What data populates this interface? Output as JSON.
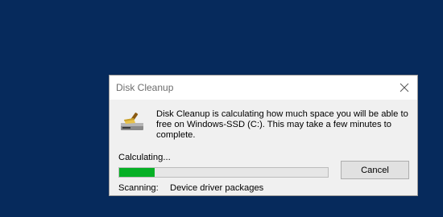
{
  "window": {
    "title": "Disk Cleanup"
  },
  "icons": {
    "app": "disk-cleanup-icon",
    "close": "close-icon"
  },
  "message": {
    "text": "Disk Cleanup is calculating how much space you will be able to free on Windows-SSD (C:). This may take a few minutes to complete."
  },
  "progress": {
    "label": "Calculating...",
    "fraction": 0.17,
    "color": "#06b025"
  },
  "buttons": {
    "cancel_label": "Cancel"
  },
  "status": {
    "scanning_label": "Scanning:",
    "scanning_item": "Device driver packages"
  },
  "colors": {
    "desktop": "#062a5c",
    "dialog_bg": "#f0f0f0",
    "titlebar_bg": "#ffffff"
  }
}
